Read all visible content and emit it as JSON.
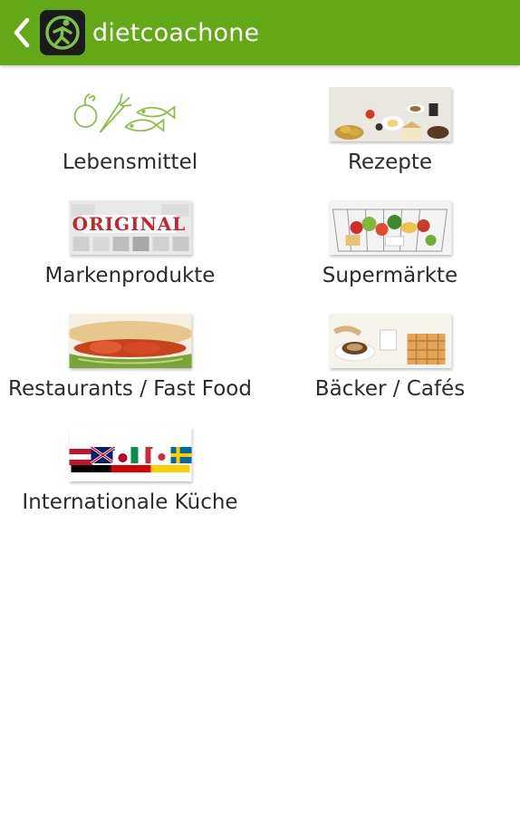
{
  "actionbar": {
    "title": "dietcoachone",
    "back_icon": "chevron-left-icon",
    "logo_icon": "app-logo-icon"
  },
  "menu": {
    "items": [
      {
        "label": "Lebensmittel"
      },
      {
        "label": "Rezepte"
      },
      {
        "label": "Markenprodukte"
      },
      {
        "label": "Supermärkte"
      },
      {
        "label": "Restaurants / Fast Food"
      },
      {
        "label": "Bäcker / Cafés"
      },
      {
        "label": "Internationale Küche"
      }
    ]
  },
  "thumb_texts": {
    "original_stamp": "ORIGINAL"
  },
  "colors": {
    "actionbar": "#63a816",
    "accent_green": "#7fb53c"
  }
}
